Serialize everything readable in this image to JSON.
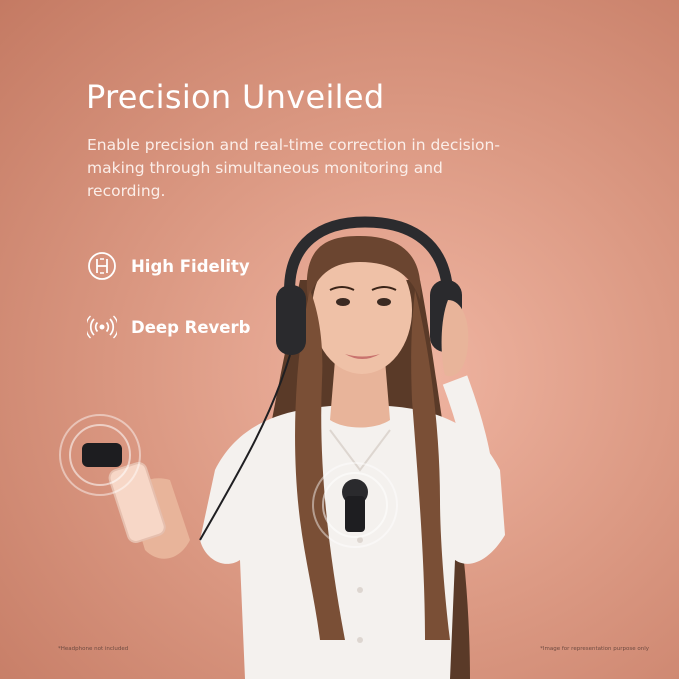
{
  "banner": {
    "title": "Precision Unveiled",
    "description": "Enable precision and real-time correction in decision-making through simultaneous monitoring and recording."
  },
  "features": [
    {
      "icon": "high-fidelity-icon",
      "label": "High Fidelity"
    },
    {
      "icon": "sound-waves-icon",
      "label": "Deep Reverb"
    }
  ],
  "footnotes": {
    "left": "*Headphone not included",
    "right": "*Image for representation purpose only"
  },
  "colors": {
    "background": "#dc9a84",
    "text": "#ffffff"
  }
}
